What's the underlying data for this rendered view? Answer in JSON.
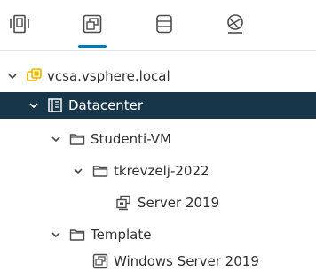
{
  "toolbar": {
    "tabs": [
      {
        "icon": "hosts-and-clusters-icon",
        "active": false
      },
      {
        "icon": "vms-and-templates-icon",
        "active": true
      },
      {
        "icon": "storage-icon",
        "active": false
      },
      {
        "icon": "networking-icon",
        "active": false
      }
    ]
  },
  "tree": {
    "nodes": [
      {
        "label": "vcsa.vsphere.local",
        "icon": "vcenter-icon",
        "expanded": true,
        "selected": false
      },
      {
        "label": "Datacenter",
        "icon": "datacenter-icon",
        "expanded": true,
        "selected": true
      },
      {
        "label": "Studenti-VM",
        "icon": "folder-icon",
        "expanded": true,
        "selected": false
      },
      {
        "label": "tkrevzelj-2022",
        "icon": "folder-icon",
        "expanded": true,
        "selected": false
      },
      {
        "label": "Server 2019",
        "icon": "vm-icon",
        "expanded": null,
        "selected": false
      },
      {
        "label": "Template",
        "icon": "folder-icon",
        "expanded": true,
        "selected": false
      },
      {
        "label": "Windows Server 2019",
        "icon": "template-icon",
        "expanded": null,
        "selected": false
      }
    ]
  },
  "colors": {
    "accent": "#0079b8",
    "selected_row": "#17364a",
    "icon_gray": "#4a4a4a",
    "vcenter_yellow": "#e8b500",
    "divider": "#dddddd"
  }
}
